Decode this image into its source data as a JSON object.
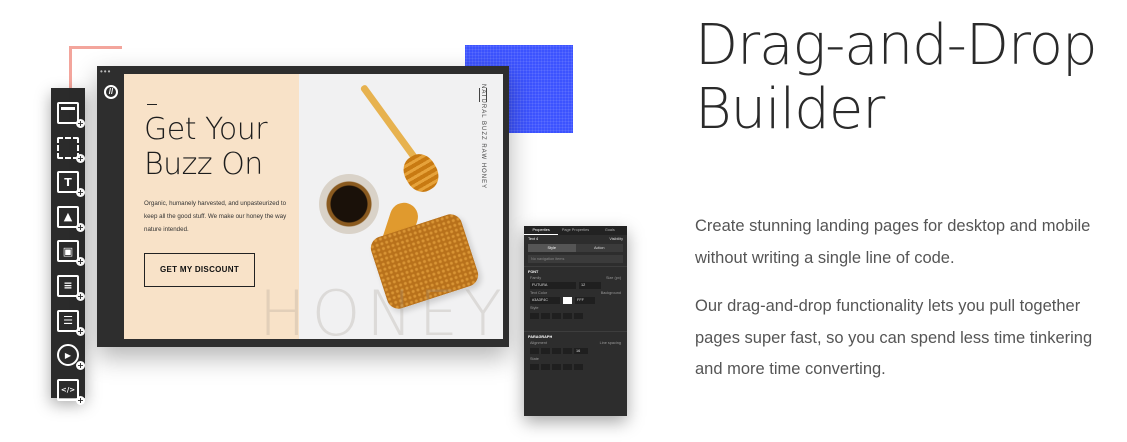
{
  "heading": "Drag-and-Drop Builder",
  "paragraphs": [
    "Create stunning landing pages for desktop and mobile without writing a single line of code.",
    "Our drag-and-drop functionality lets you pull together pages super fast, so you can spend less time tinkering and more time converting."
  ],
  "builder": {
    "logo_glyph": "//",
    "toolbox": [
      {
        "name": "section-icon",
        "glyph": ""
      },
      {
        "name": "box-icon",
        "glyph": ""
      },
      {
        "name": "text-icon",
        "glyph": "T"
      },
      {
        "name": "image-icon",
        "glyph": "▲"
      },
      {
        "name": "button-icon",
        "glyph": "▣"
      },
      {
        "name": "form-icon",
        "glyph": "≡"
      },
      {
        "name": "list-icon",
        "glyph": "☰"
      },
      {
        "name": "video-icon",
        "glyph": "▶"
      },
      {
        "name": "code-icon",
        "glyph": "</>"
      }
    ],
    "add_glyph": "+",
    "page": {
      "title": "Get Your Buzz On",
      "body": "Organic, humanely harvested, and unpasteurized to keep all the good stuff. We make our honey the way nature intended.",
      "button": "GET MY DISCOUNT",
      "side_text": "NATURAL BUZZ RAW HONEY",
      "watermark": "HONEY"
    },
    "panel": {
      "tabs": [
        "Properties",
        "Page Properties",
        "Goals"
      ],
      "element": "Text 4",
      "visibility": "Visibility",
      "subtabs": [
        "Style",
        "Action"
      ],
      "search_placeholder": "No navigation items",
      "font_section": "FONT",
      "family_label": "Family",
      "family_value": "FUTURA",
      "size_label": "Size (px)",
      "size_value": "12",
      "text_color_label": "Text Color",
      "text_color_value": "#3A3F4C",
      "background_label": "Background",
      "background_value": "FFF",
      "style_label": "Style",
      "paragraph_section": "PARAGRAPH",
      "alignment_label": "Alignment",
      "line_spacing_label": "Line spacing",
      "line_spacing_value": "16",
      "state_label": "State"
    }
  },
  "colors": {
    "accent_blue": "#3c53ff",
    "accent_pink": "#f3a59c",
    "page_bg": "#f8e2c8",
    "dark_ui": "#2d2d2d"
  }
}
